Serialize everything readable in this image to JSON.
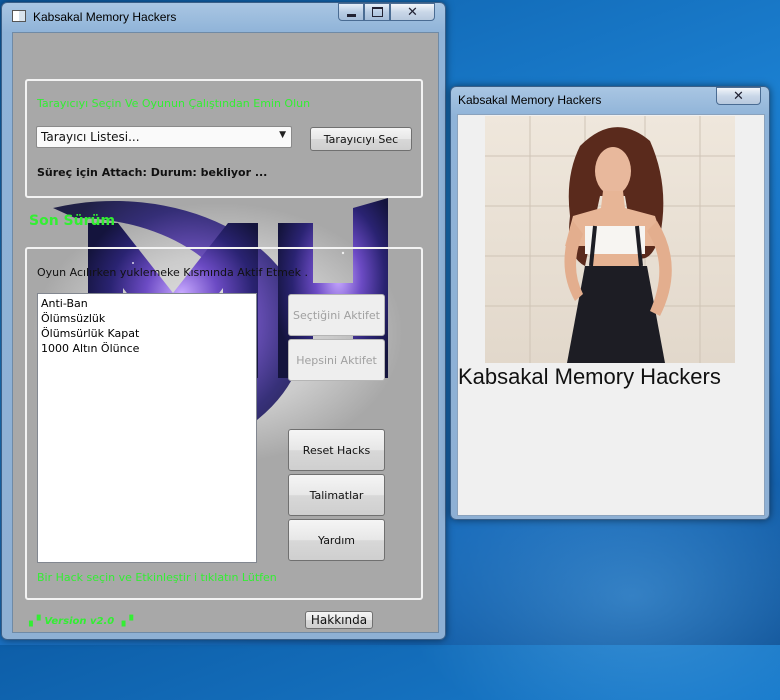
{
  "main_window": {
    "title": "Kabsakal Memory Hackers",
    "browser_group": {
      "instruction": "Tarayıcıyı Seçin Ve Oyunun Çalıştından Emin Olun",
      "dropdown_value": "Tarayıcı Listesi...",
      "select_button": "Tarayıcıyı Sec",
      "status": "Süreç için Attach: Durum: bekliyor ..."
    },
    "latest_version_label": "Son Sürüm",
    "hacks_group": {
      "note": "Oyun Acılırken yuklemeke Kısmında Aktif Etmek .",
      "hacks": [
        "Anti-Ban",
        "Ölümsüzlük",
        "Ölümsürlük Kapat",
        "1000 Altın Ölünce"
      ],
      "activate_selected": "Seçtiğini Aktifet",
      "activate_all": "Hepsini Aktifet",
      "reset": "Reset Hacks",
      "instructions": "Talimatlar",
      "help": "Yardım",
      "hint": "Bir Hack seçin ve Etkinleştir i tıklatın Lütfen"
    },
    "version": "Version v2.0",
    "about_button": "Hakkında"
  },
  "second_window": {
    "title": "Kabsakal Memory Hackers",
    "caption": "Kabsakal Memory Hackers"
  },
  "colors": {
    "accent_green": "#33ee33",
    "client_gray": "#a8a8a8",
    "logo_purple": "#5b3fa8"
  },
  "icons": [
    "app-icon",
    "minimize-icon",
    "maximize-icon",
    "close-icon",
    "dropdown-arrow-icon"
  ]
}
